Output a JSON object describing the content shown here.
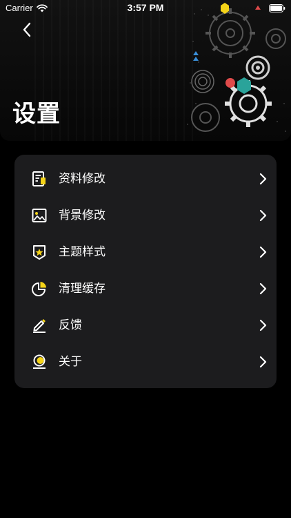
{
  "status_bar": {
    "carrier": "Carrier",
    "time": "3:57 PM"
  },
  "header": {
    "title": "设置"
  },
  "settings": {
    "items": [
      {
        "label": "资料修改",
        "icon": "profile-edit-icon"
      },
      {
        "label": "背景修改",
        "icon": "image-icon"
      },
      {
        "label": "主题样式",
        "icon": "theme-star-icon"
      },
      {
        "label": "清理缓存",
        "icon": "pie-chart-icon"
      },
      {
        "label": "反馈",
        "icon": "pencil-icon"
      },
      {
        "label": "关于",
        "icon": "about-icon"
      }
    ]
  },
  "colors": {
    "background": "#000000",
    "card": "#1c1c1e",
    "accent": "#f5d418",
    "text": "#ffffff"
  }
}
